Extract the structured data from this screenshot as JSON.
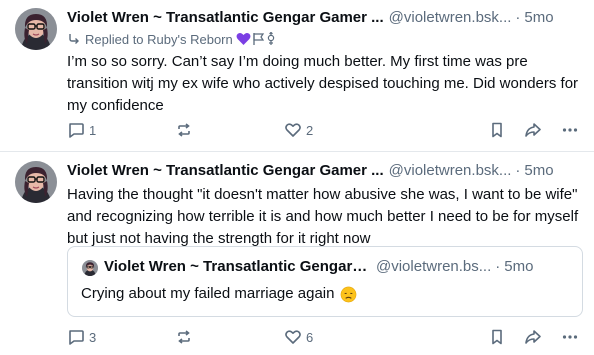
{
  "posts": [
    {
      "display_name": "Violet Wren ~ Transatlantic Gengar Gamer ...",
      "handle": "@violetwren.bsk...",
      "separator": "·",
      "timestamp": "5mo",
      "reply_to": "Replied to Ruby's Reborn",
      "reply_flags": [
        "purple-heart-icon",
        "flag-icon",
        "transgender-symbol-icon"
      ],
      "text": "I’m so so sorry. Can’t say I’m doing much better. My first time was pre transition witj my ex wife who actively despised touching me. Did wonders for my confidence",
      "reply_count": "1",
      "repost_count": "",
      "like_count": "2"
    },
    {
      "display_name": "Violet Wren ~ Transatlantic Gengar Gamer ...",
      "handle": "@violetwren.bsk...",
      "separator": "·",
      "timestamp": "5mo",
      "text": "Having the thought \"it doesn't matter how abusive she was, I want to be wife\" and recognizing how terrible it is and how much better I need to be for myself but just not having the strength for it right now",
      "quote": {
        "display_name": "Violet Wren ~ Transatlantic Gengar Ga...",
        "handle": "@violetwren.bs...",
        "separator": "·",
        "timestamp": "5mo",
        "text": "Crying about my failed marriage again",
        "emoji": "disappointed-face-emoji"
      },
      "reply_count": "3",
      "repost_count": "",
      "like_count": "6"
    }
  ],
  "colors": {
    "text": "#0b0f14",
    "muted": "#5b6b7c",
    "divider": "#e4e8ec",
    "heart_purple": "#7b3fe4"
  }
}
